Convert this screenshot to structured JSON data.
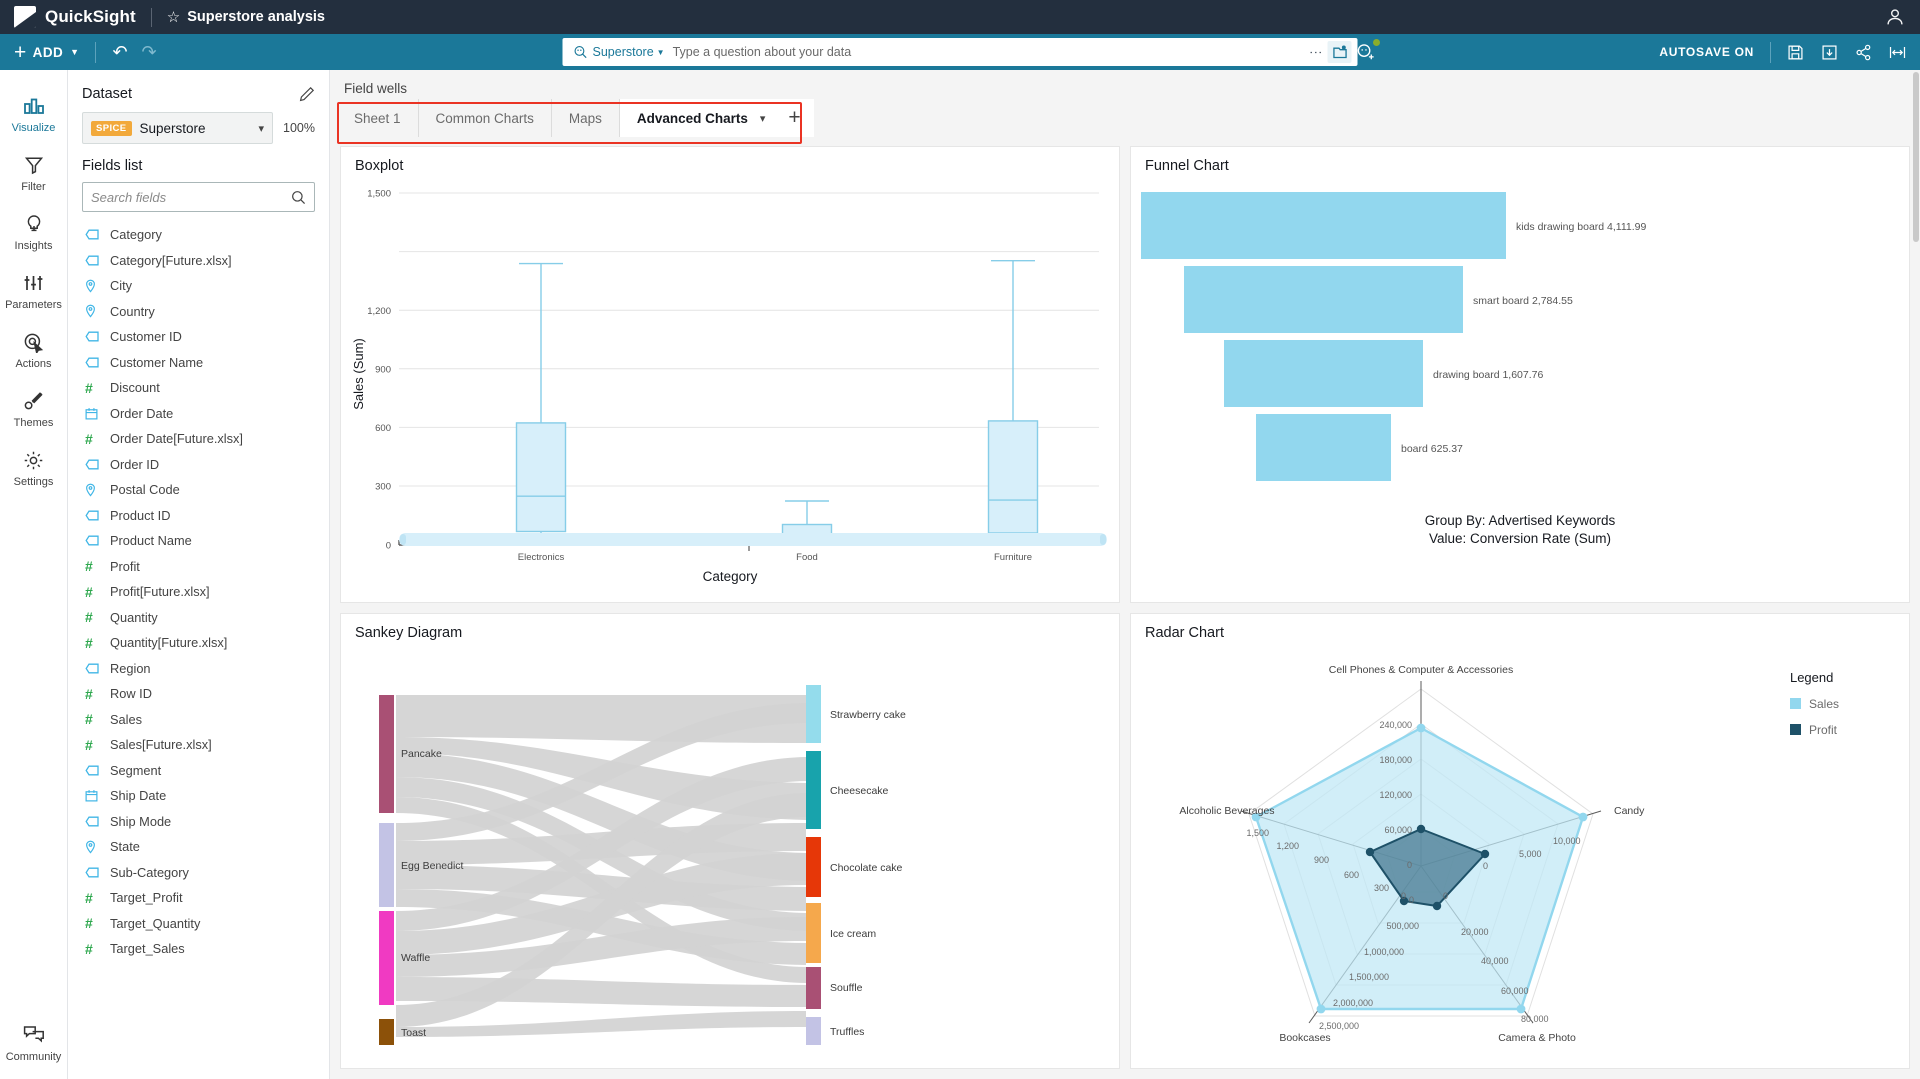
{
  "topbar": {
    "product": "QuickSight",
    "analysis_title": "Superstore analysis",
    "star_icon": "star-icon",
    "user_icon": "user-account-icon"
  },
  "toolbar": {
    "add_label": "ADD",
    "undo_icon": "undo-icon",
    "redo_icon": "redo-icon",
    "autosave_label": "AUTOSAVE ON",
    "save_icon": "save-icon",
    "download_icon": "download-icon",
    "share_icon": "share-icon",
    "fit_icon": "fit-to-width-icon",
    "search": {
      "source": "Superstore",
      "placeholder": "Type a question about your data",
      "kebab_icon": "more-options-icon",
      "topic_icon": "topic-icon",
      "ask_icon": "ask-question-add-icon"
    }
  },
  "rail": {
    "items": [
      {
        "label": "Visualize",
        "icon": "bar-chart-icon",
        "active": true
      },
      {
        "label": "Filter",
        "icon": "funnel-filter-icon",
        "active": false
      },
      {
        "label": "Insights",
        "icon": "lightbulb-icon",
        "active": false
      },
      {
        "label": "Parameters",
        "icon": "sliders-icon",
        "active": false
      },
      {
        "label": "Actions",
        "icon": "target-cursor-icon",
        "active": false
      },
      {
        "label": "Themes",
        "icon": "paintbrush-icon",
        "active": false
      },
      {
        "label": "Settings",
        "icon": "gear-icon",
        "active": false
      }
    ],
    "bottom": {
      "label": "Community",
      "icon": "chat-bubbles-icon"
    }
  },
  "fields_panel": {
    "dataset_label": "Dataset",
    "edit_icon": "pencil-icon",
    "spice_badge": "SPICE",
    "dataset_name": "Superstore",
    "dataset_percent": "100%",
    "fields_list_label": "Fields list",
    "search_placeholder": "Search fields",
    "search_value": "",
    "search_icon": "search-icon",
    "fields": [
      {
        "name": "Category",
        "type": "string"
      },
      {
        "name": "Category[Future.xlsx]",
        "type": "string"
      },
      {
        "name": "City",
        "type": "geo"
      },
      {
        "name": "Country",
        "type": "geo"
      },
      {
        "name": "Customer ID",
        "type": "string"
      },
      {
        "name": "Customer Name",
        "type": "string"
      },
      {
        "name": "Discount",
        "type": "number"
      },
      {
        "name": "Order Date",
        "type": "date"
      },
      {
        "name": "Order Date[Future.xlsx]",
        "type": "number"
      },
      {
        "name": "Order ID",
        "type": "string"
      },
      {
        "name": "Postal Code",
        "type": "geo"
      },
      {
        "name": "Product ID",
        "type": "string"
      },
      {
        "name": "Product Name",
        "type": "string"
      },
      {
        "name": "Profit",
        "type": "number"
      },
      {
        "name": "Profit[Future.xlsx]",
        "type": "number"
      },
      {
        "name": "Quantity",
        "type": "number"
      },
      {
        "name": "Quantity[Future.xlsx]",
        "type": "number"
      },
      {
        "name": "Region",
        "type": "string"
      },
      {
        "name": "Row ID",
        "type": "number"
      },
      {
        "name": "Sales",
        "type": "number"
      },
      {
        "name": "Sales[Future.xlsx]",
        "type": "number"
      },
      {
        "name": "Segment",
        "type": "string"
      },
      {
        "name": "Ship Date",
        "type": "date"
      },
      {
        "name": "Ship Mode",
        "type": "string"
      },
      {
        "name": "State",
        "type": "geo"
      },
      {
        "name": "Sub-Category",
        "type": "string"
      },
      {
        "name": "Target_Profit",
        "type": "number"
      },
      {
        "name": "Target_Quantity",
        "type": "number"
      },
      {
        "name": "Target_Sales",
        "type": "number"
      }
    ]
  },
  "canvas": {
    "field_wells_label": "Field wells",
    "tabs": [
      {
        "label": "Sheet 1",
        "active": false
      },
      {
        "label": "Common Charts",
        "active": false
      },
      {
        "label": "Maps",
        "active": false
      },
      {
        "label": "Advanced Charts",
        "active": true
      }
    ],
    "add_tab_icon": "plus-icon",
    "highlight_color": "#ea3323"
  },
  "chart_data": [
    {
      "type": "boxplot",
      "title": "Boxplot",
      "xlabel": "Category",
      "ylabel": "Sales (Sum)",
      "yticks": [
        "0",
        "300",
        "600",
        "900",
        "1,200",
        "1,500"
      ],
      "ylim": [
        0,
        1500
      ],
      "categories": [
        "Electronics",
        "Food",
        "Furniture"
      ],
      "boxes": [
        {
          "category": "Electronics",
          "min": 5,
          "q1": 70,
          "median": 250,
          "q3": 630,
          "max": 1440
        },
        {
          "category": "Food",
          "min": 5,
          "q1": 18,
          "median": 30,
          "q3": 105,
          "max": 225
        },
        {
          "category": "Furniture",
          "min": 5,
          "q1": 60,
          "median": 230,
          "q3": 640,
          "max": 1455
        }
      ],
      "grid": true,
      "has_scrollbar": true
    },
    {
      "type": "funnel",
      "title": "Funnel Chart",
      "group_by_text": "Group By: Advertised Keywords",
      "value_text": "Value: Conversion Rate (Sum)",
      "color": "#92d7ee",
      "stages": [
        {
          "label": "kids drawing board",
          "value": 4111.99,
          "value_text": "kids drawing board 4,111.99"
        },
        {
          "label": "smart board",
          "value": 2784.55,
          "value_text": "smart board 2,784.55"
        },
        {
          "label": "drawing board",
          "value": 1607.76,
          "value_text": "drawing board 1,607.76"
        },
        {
          "label": "board",
          "value": 625.37,
          "value_text": "board 625.37"
        }
      ]
    },
    {
      "type": "sankey",
      "title": "Sankey Diagram",
      "source_nodes": [
        {
          "label": "Pancake",
          "color": "#a95074",
          "weight": 33
        },
        {
          "label": "Egg Benedict",
          "color": "#c3c3e5",
          "weight": 25
        },
        {
          "label": "Waffle",
          "color": "#f03ac2",
          "weight": 26
        },
        {
          "label": "Toast",
          "color": "#8c5109",
          "weight": 6
        }
      ],
      "target_nodes": [
        {
          "label": "Strawberry cake",
          "color": "#94dcec",
          "weight": 14
        },
        {
          "label": "Cheesecake",
          "color": "#18a3ac",
          "weight": 22
        },
        {
          "label": "Chocolate cake",
          "color": "#e63708",
          "weight": 16
        },
        {
          "label": "Ice cream",
          "color": "#f5a84c",
          "weight": 16
        },
        {
          "label": "Souffle",
          "color": "#a95074",
          "weight": 10
        },
        {
          "label": "Truffles",
          "color": "#c3c3e5",
          "weight": 5
        }
      ],
      "link_color": "#d3d3d3"
    },
    {
      "type": "radar",
      "title": "Radar Chart",
      "legend_title": "Legend",
      "axes": [
        "Cell Phones & Computer & Accessories",
        "Candy",
        "Camera & Photo",
        "Bookcases",
        "Alcoholic Beverages"
      ],
      "axis_ticks": {
        "Cell Phones & Computer & Accessories": [
          "0",
          "60,000",
          "120,000",
          "180,000",
          "240,000"
        ],
        "Candy": [
          "0",
          "5,000",
          "10,000"
        ],
        "Camera & Photo": [
          "0",
          "20,000",
          "40,000",
          "60,000",
          "80,000"
        ],
        "Bookcases": [
          "0",
          "500,000",
          "1,000,000",
          "1,500,000",
          "2,000,000",
          "2,500,000"
        ],
        "Alcoholic Beverages": [
          "0",
          "300",
          "600",
          "900",
          "1,200",
          "1,500"
        ]
      },
      "series": [
        {
          "name": "Sales",
          "color": "#92d7ee",
          "values_normalized": [
            0.79,
            0.95,
            0.96,
            0.96,
            0.94
          ]
        },
        {
          "name": "Profit",
          "color": "#1e5168",
          "values_normalized": [
            0.2,
            0.33,
            0.07,
            0.09,
            0.22
          ]
        }
      ]
    }
  ]
}
